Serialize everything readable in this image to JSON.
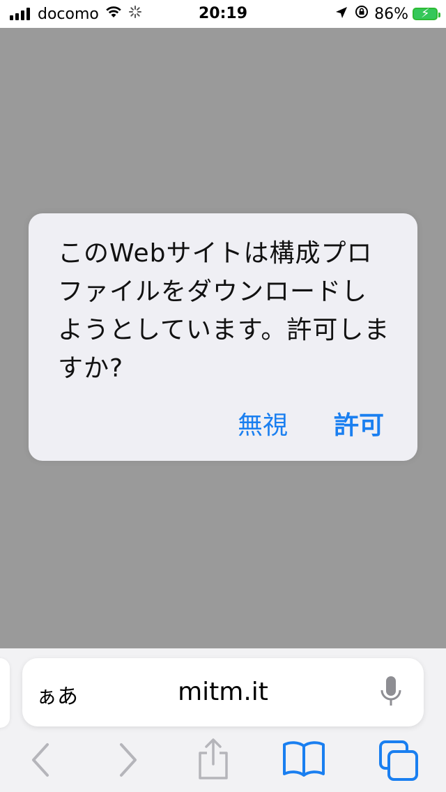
{
  "status_bar": {
    "carrier": "docomo",
    "time": "20:19",
    "battery_percent": "86%",
    "signal_bars": 4,
    "icons": [
      "signal-icon",
      "wifi-icon",
      "activity-spinner-icon",
      "location-arrow-icon",
      "orientation-lock-icon",
      "battery-charging-icon"
    ]
  },
  "alert": {
    "message": "このWebサイトは構成プロファイルをダウンロードしようとしています。許可しますか?",
    "ignore_label": "無視",
    "allow_label": "許可"
  },
  "address_bar": {
    "text_size_label": "ぁあ",
    "url": "mitm.it"
  },
  "toolbar": {
    "items": [
      "back-icon",
      "forward-icon",
      "share-icon",
      "bookmarks-icon",
      "tabs-icon"
    ]
  },
  "colors": {
    "accent": "#1a7ff0",
    "dim_overlay": "#9a9a9a",
    "alert_bg": "#efeff4",
    "battery": "#34c759",
    "disabled_icon": "#b5b5ba"
  }
}
